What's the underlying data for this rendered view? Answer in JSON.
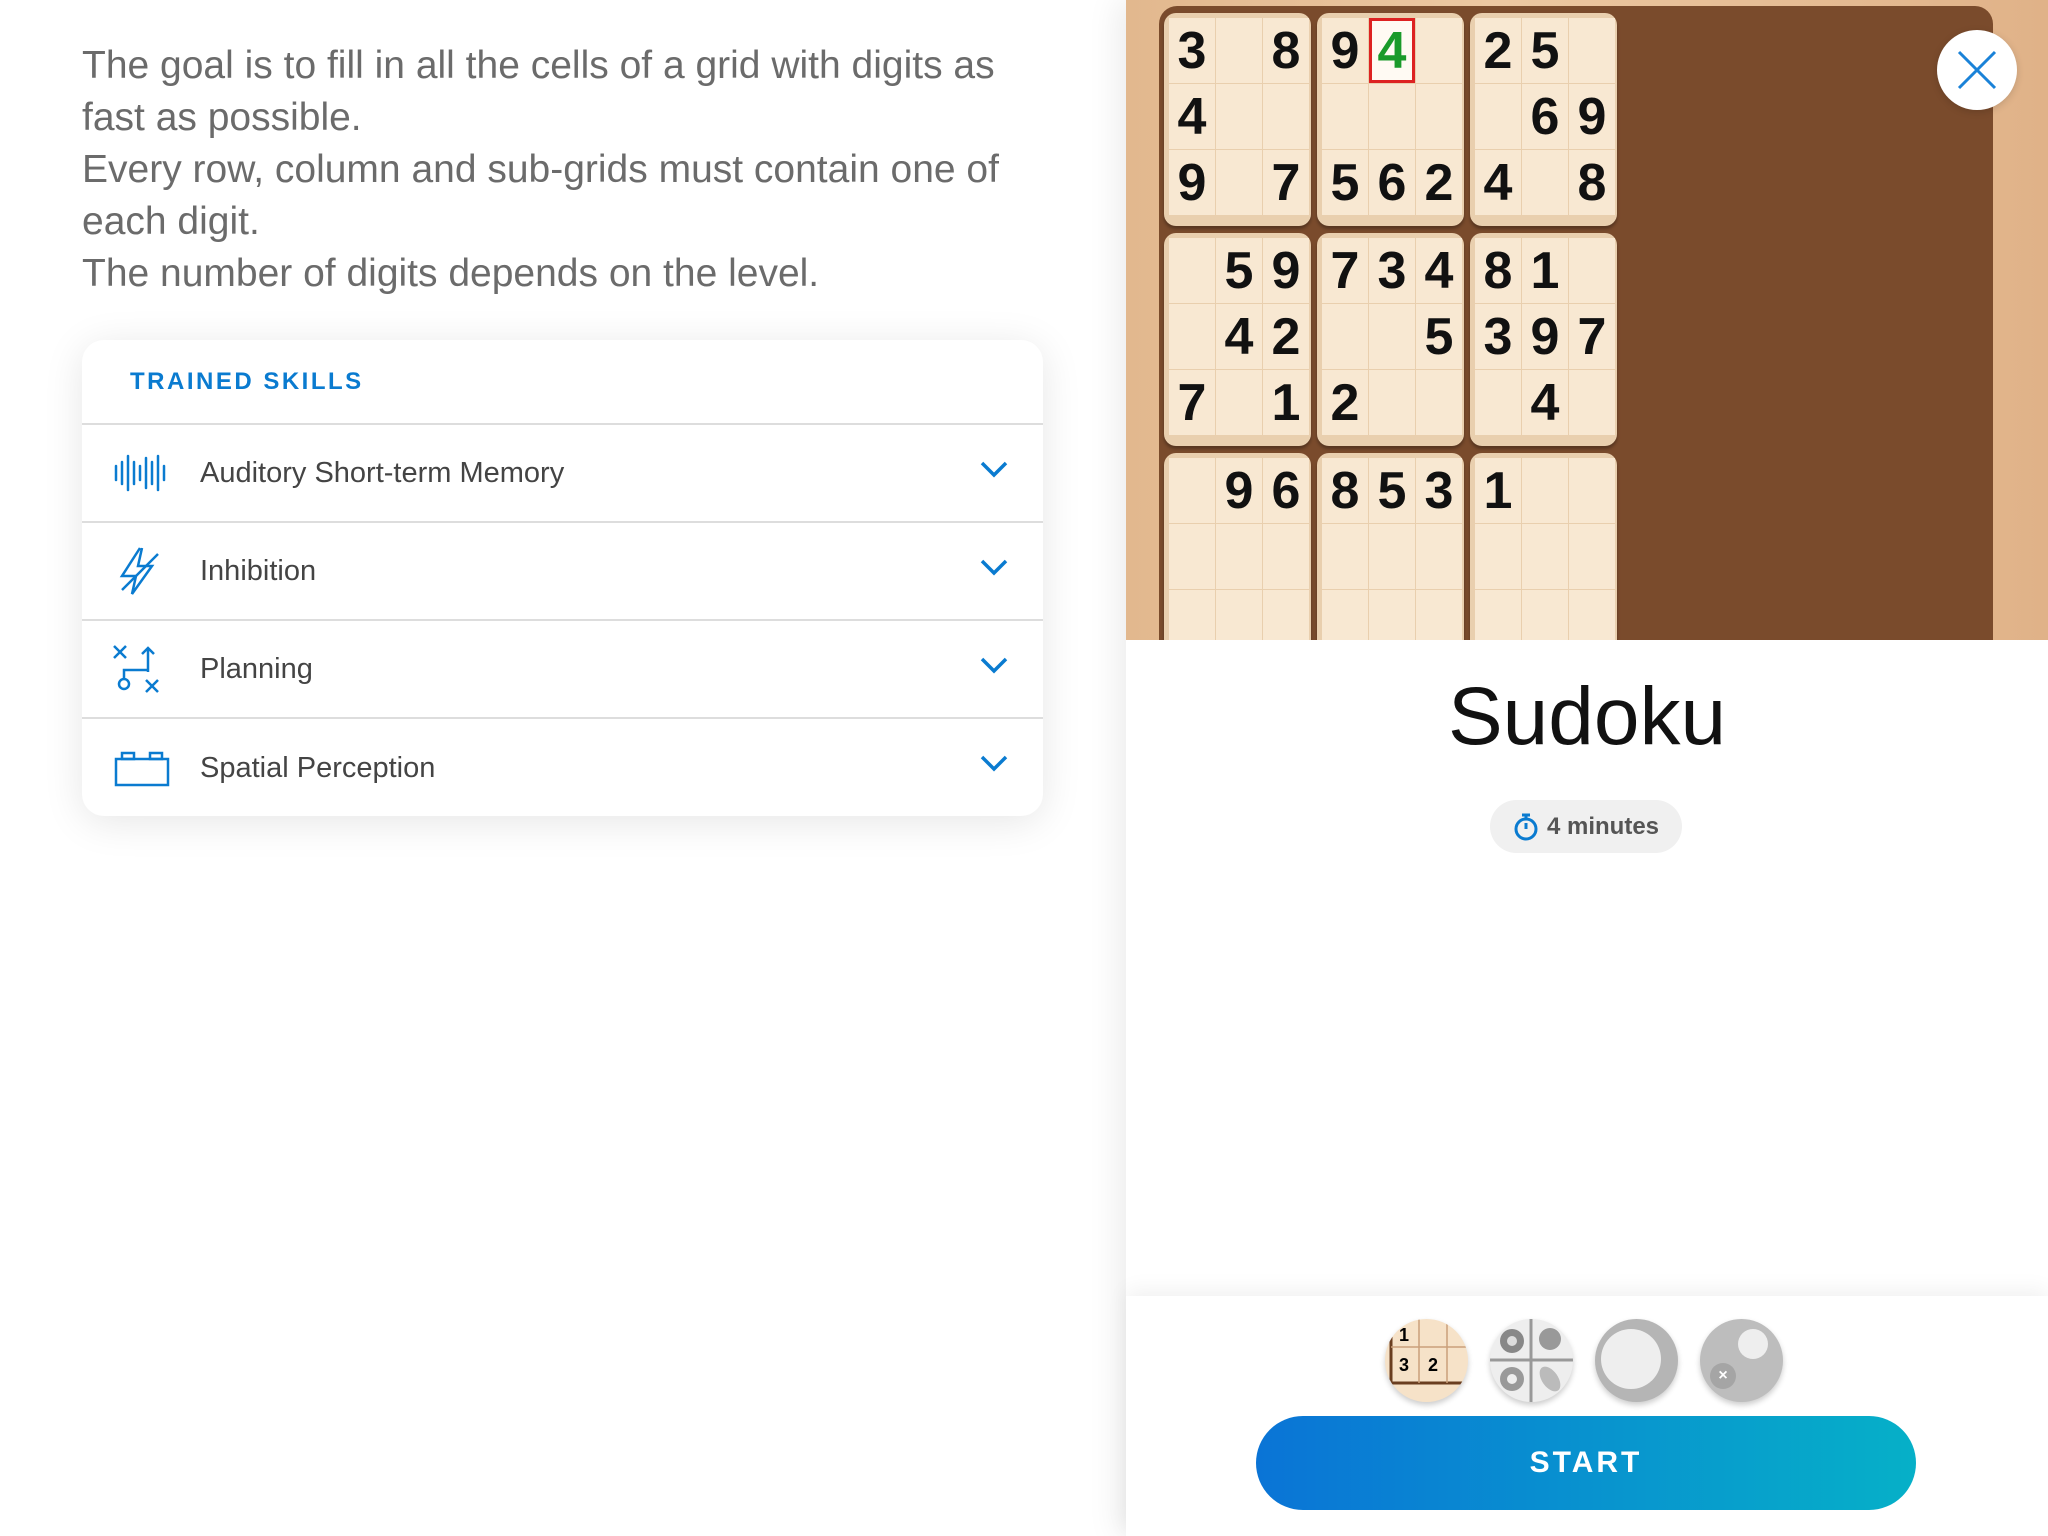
{
  "description": [
    "The goal is to fill in all the cells of a grid with digits as fast as possible.",
    "Every row, column and sub-grids must contain one of each digit.",
    "The number of digits depends on the level."
  ],
  "skills": {
    "header": "TRAINED SKILLS",
    "items": [
      {
        "label": "Auditory Short-term Memory",
        "icon": "sound-wave-icon"
      },
      {
        "label": "Inhibition",
        "icon": "lightning-icon"
      },
      {
        "label": "Planning",
        "icon": "strategy-icon"
      },
      {
        "label": "Spatial Perception",
        "icon": "building-block-icon"
      }
    ]
  },
  "game": {
    "title": "Sudoku",
    "duration": "4 minutes",
    "start_label": "START",
    "grid": [
      [
        "3",
        "",
        "8",
        "9",
        "4",
        "",
        "2",
        "5",
        ""
      ],
      [
        "4",
        "",
        "",
        "",
        "",
        "",
        "",
        "6",
        "9"
      ],
      [
        "9",
        "",
        "7",
        "5",
        "6",
        "2",
        "4",
        "",
        "8"
      ],
      [
        "",
        "5",
        "9",
        "7",
        "3",
        "4",
        "8",
        "1",
        ""
      ],
      [
        "",
        "4",
        "2",
        "",
        "",
        "5",
        "3",
        "9",
        "7"
      ],
      [
        "7",
        "",
        "1",
        "2",
        "",
        "",
        "",
        "4",
        ""
      ],
      [
        "",
        "9",
        "6",
        "8",
        "5",
        "3",
        "1",
        "",
        ""
      ]
    ],
    "selected_cell": [
      0,
      4
    ],
    "thumbnails": [
      {
        "name": "sudoku-level-thumb",
        "digits": [
          "1",
          "3",
          "2"
        ]
      },
      {
        "name": "flowers-level-thumb"
      },
      {
        "name": "circle-level-thumb"
      },
      {
        "name": "dots-level-thumb"
      }
    ]
  },
  "colors": {
    "accent": "#0a7bd0",
    "selected_digit": "#1a9a2a",
    "selected_border": "#dd2222"
  }
}
